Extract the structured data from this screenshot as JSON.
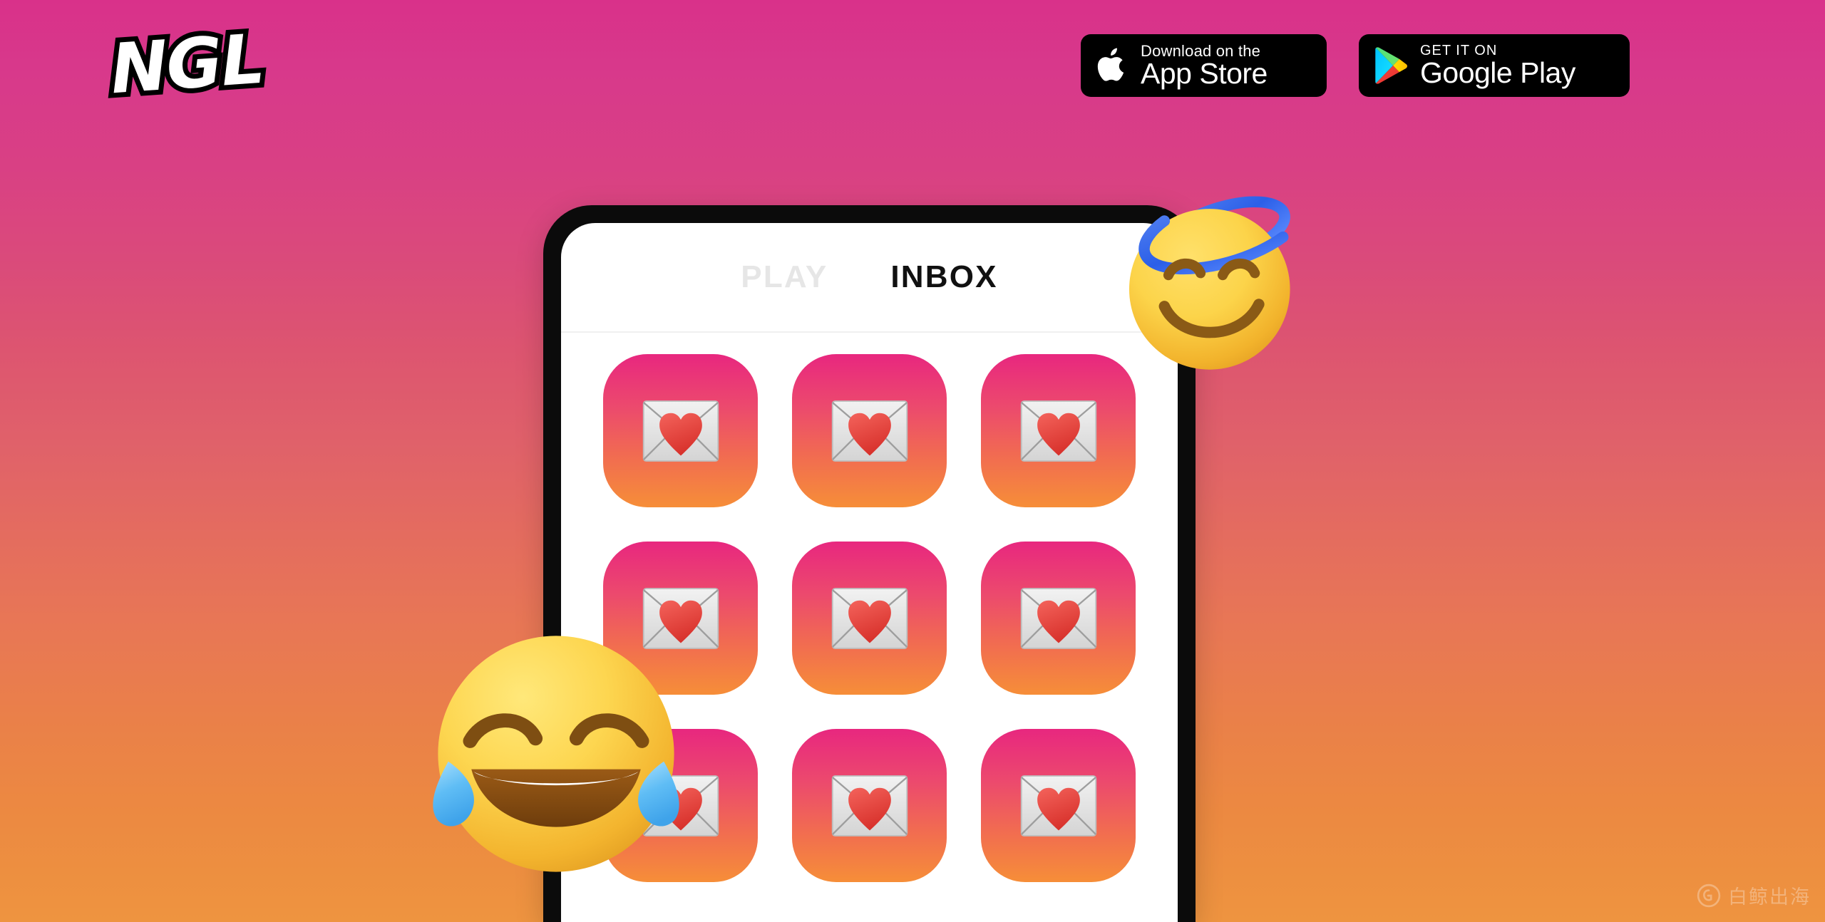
{
  "background": {
    "gradient_top": "#d9318a",
    "gradient_bottom": "#ee9440"
  },
  "header": {
    "logo_text": "NGL",
    "store_badges": [
      {
        "id": "app-store",
        "icon": "apple-icon",
        "small_text": "Download on the",
        "large_text": "App Store",
        "background": "#000000"
      },
      {
        "id": "google-play",
        "icon": "google-play-icon",
        "small_text": "GET IT ON",
        "large_text": "Google Play",
        "background": "#000000"
      }
    ]
  },
  "phone": {
    "frame_color": "#0b0b0b",
    "screen_color": "#ffffff",
    "tabs": [
      {
        "label": "PLAY",
        "active": false,
        "color": "#e6e6e6"
      },
      {
        "label": "INBOX",
        "active": true,
        "color": "#111111"
      }
    ],
    "inbox": {
      "tile_gradient_top": "#e8277f",
      "tile_gradient_bottom": "#f68e38",
      "tile_icon": "love-letter-icon",
      "tiles": [
        {
          "index": 1,
          "icon": "love-letter-icon"
        },
        {
          "index": 2,
          "icon": "love-letter-icon"
        },
        {
          "index": 3,
          "icon": "love-letter-icon"
        },
        {
          "index": 4,
          "icon": "love-letter-icon"
        },
        {
          "index": 5,
          "icon": "love-letter-icon"
        },
        {
          "index": 6,
          "icon": "love-letter-icon"
        },
        {
          "index": 7,
          "icon": "love-letter-icon"
        },
        {
          "index": 8,
          "icon": "love-letter-icon"
        },
        {
          "index": 9,
          "icon": "love-letter-icon"
        }
      ]
    }
  },
  "decorations": {
    "emojis": [
      {
        "id": "angel",
        "name": "smiling-face-with-halo-emoji",
        "glyph": "😇"
      },
      {
        "id": "joy",
        "name": "face-with-tears-of-joy-emoji",
        "glyph": "😂"
      }
    ]
  },
  "watermark": {
    "text": "白鲸出海",
    "icon": "whale-logo-icon"
  }
}
